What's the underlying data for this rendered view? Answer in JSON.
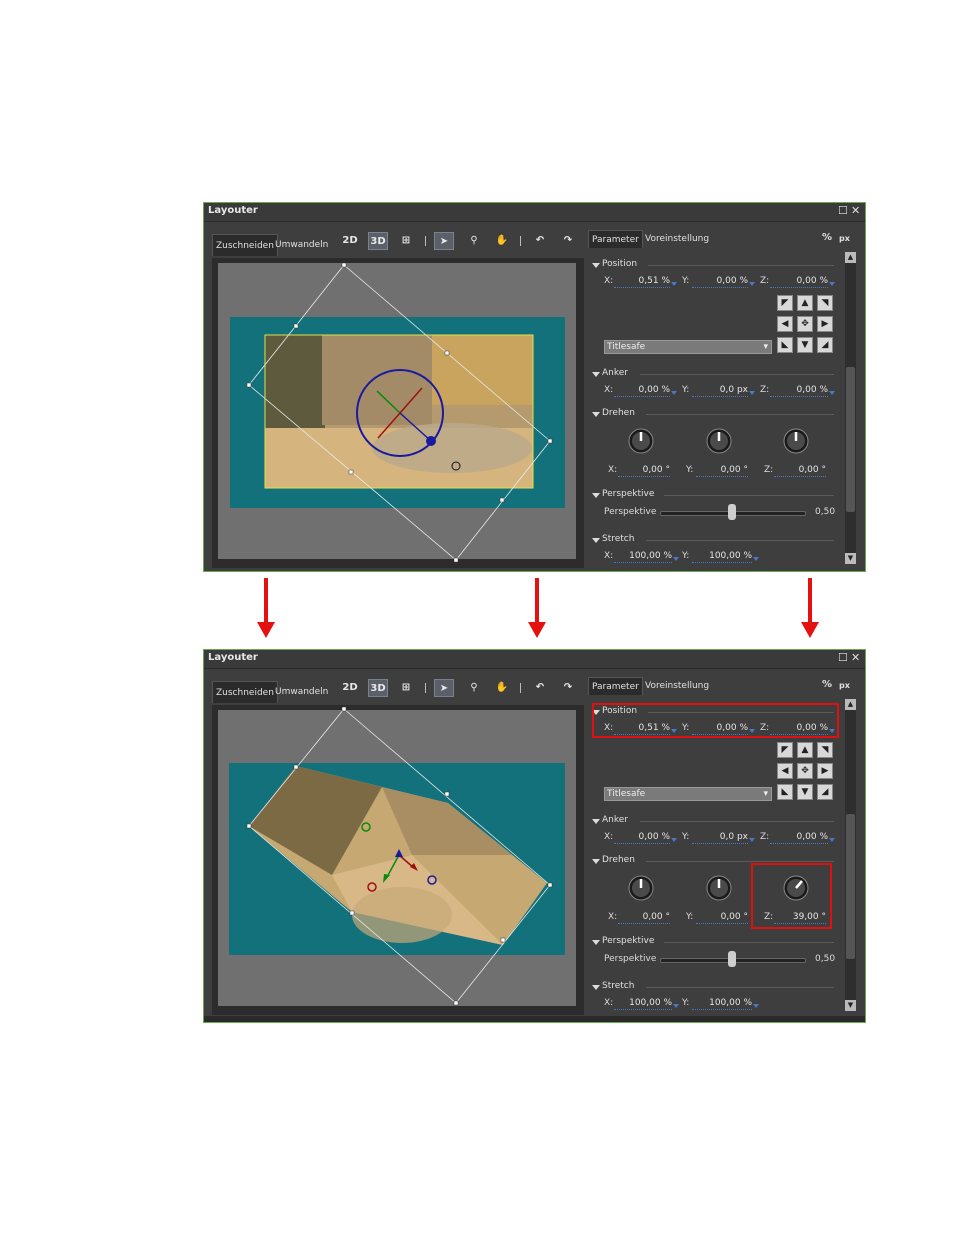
{
  "layouter": {
    "title": "Layouter",
    "tabs": [
      "Zuschneiden",
      "Umwandeln"
    ],
    "tools": {
      "two_d": "2D",
      "three_d": "3D"
    },
    "panel_tabs": [
      "Parameter",
      "Voreinstellung"
    ],
    "units": {
      "percent": "%",
      "px": "px"
    },
    "sections": {
      "position": "Position",
      "anker": "Anker",
      "drehen": "Drehen",
      "perspektive": "Perspektive",
      "stretch": "Stretch"
    },
    "axis": {
      "x": "X:",
      "y": "Y:",
      "z": "Z:"
    },
    "perspektive_label": "Perspektive",
    "dropdown_value": "Titlesafe"
  },
  "before": {
    "position": {
      "x": "0,51 %",
      "y": "0,00 %",
      "z": "0,00 %"
    },
    "anker": {
      "x": "0,00 %",
      "y": "0,0 px",
      "z": "0,00 %"
    },
    "drehen": {
      "x": "0,00 °",
      "y": "0,00 °",
      "z": "0,00 °"
    },
    "perspektive": "0,50",
    "stretch": {
      "x": "100,00 %",
      "y": "100,00 %"
    }
  },
  "after": {
    "position": {
      "x": "0,51 %",
      "y": "0,00 %",
      "z": "0,00 %"
    },
    "anker": {
      "x": "0,00 %",
      "y": "0,0 px",
      "z": "0,00 %"
    },
    "drehen": {
      "x": "0,00 °",
      "y": "0,00 °",
      "z": "39,00 °"
    },
    "perspektive": "0,50",
    "stretch": {
      "x": "100,00 %",
      "y": "100,00 %"
    }
  },
  "colors": {
    "highlight": "#e01010",
    "arrow": "#e51010",
    "stage": "#12717a",
    "rotate_gizmo": "#1a1aa0"
  },
  "icons": [
    "close-icon",
    "maximize-icon",
    "select-arrow-icon",
    "zoom-icon",
    "hand-icon",
    "undo-icon",
    "redo-icon",
    "grid-icon"
  ]
}
